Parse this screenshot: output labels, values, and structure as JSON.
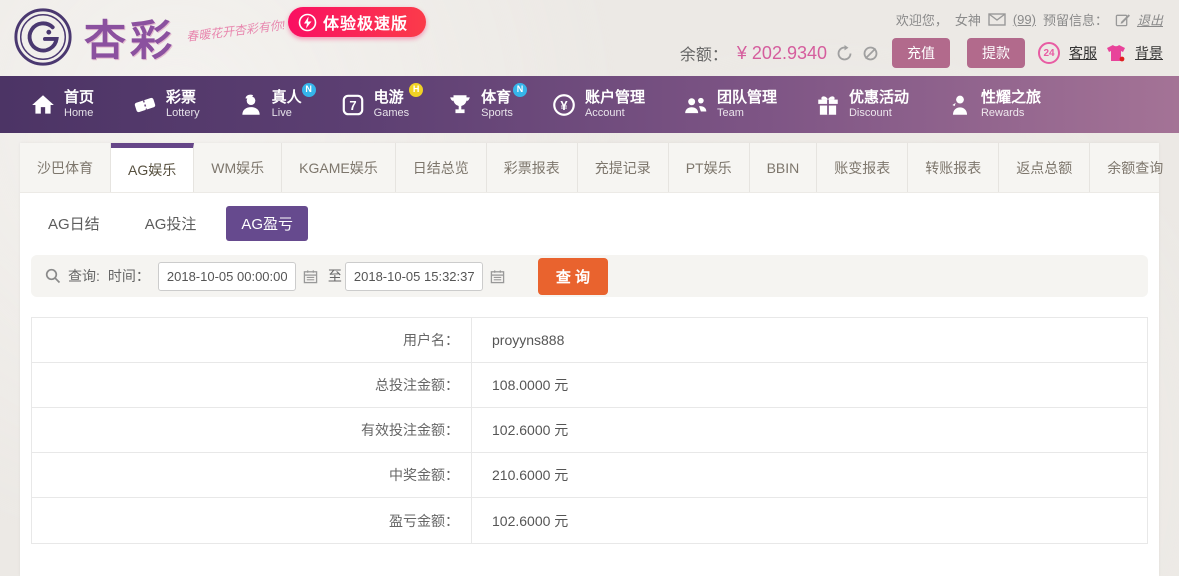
{
  "header": {
    "brand": "杏彩",
    "slogan": "春暖花开杏彩有你!",
    "speed_badge": "体验极速版",
    "welcome": {
      "greeting": "欢迎您，",
      "username": "女神",
      "mail_count": "(99)",
      "reserved_info": "预留信息：",
      "logout": "退出"
    },
    "balance": {
      "label": "余额：",
      "amount": "¥ 202.9340",
      "recharge": "充值",
      "withdraw": "提款",
      "service_badge": "24",
      "service": "客服",
      "background": "背景"
    }
  },
  "nav": {
    "items": [
      {
        "zh": "首页",
        "en": "Home"
      },
      {
        "zh": "彩票",
        "en": "Lottery"
      },
      {
        "zh": "真人",
        "en": "Live",
        "badge": "N"
      },
      {
        "zh": "电游",
        "en": "Games",
        "badge": "H"
      },
      {
        "zh": "体育",
        "en": "Sports",
        "badge": "N"
      },
      {
        "zh": "账户管理",
        "en": "Account"
      },
      {
        "zh": "团队管理",
        "en": "Team"
      },
      {
        "zh": "优惠活动",
        "en": "Discount"
      },
      {
        "zh": "性耀之旅",
        "en": "Rewards"
      }
    ]
  },
  "tabs": {
    "items": [
      "沙巴体育",
      "AG娱乐",
      "WM娱乐",
      "KGAME娱乐",
      "日结总览",
      "彩票报表",
      "充提记录",
      "PT娱乐",
      "BBIN",
      "账变报表",
      "转账报表",
      "返点总额",
      "余额查询"
    ],
    "active": "AG娱乐"
  },
  "subtabs": {
    "items": [
      "AG日结",
      "AG投注",
      "AG盈亏"
    ],
    "active": "AG盈亏"
  },
  "query": {
    "search_label": "查询:",
    "time_label": "时间：",
    "from_value": "2018-10-05 00:00:00",
    "to_separator": "至",
    "to_value": "2018-10-05 15:32:37",
    "submit_label": "查 询"
  },
  "report": {
    "rows": [
      {
        "label": "用户名：",
        "value": "proyyns888"
      },
      {
        "label": "总投注金额：",
        "value": "108.0000 元"
      },
      {
        "label": "有效投注金额：",
        "value": "102.6000 元"
      },
      {
        "label": "中奖金额：",
        "value": "210.6000 元"
      },
      {
        "label": "盈亏金额：",
        "value": "102.6000 元"
      }
    ]
  },
  "colors": {
    "accent_purple": "#664a8e",
    "nav_gradient_start": "#4c3465",
    "nav_gradient_end": "#a47396",
    "balance_pink": "#d55d9d",
    "button_mauve": "#b26a8c",
    "query_orange": "#e9632e",
    "promo_pink": "#fa0f62"
  }
}
